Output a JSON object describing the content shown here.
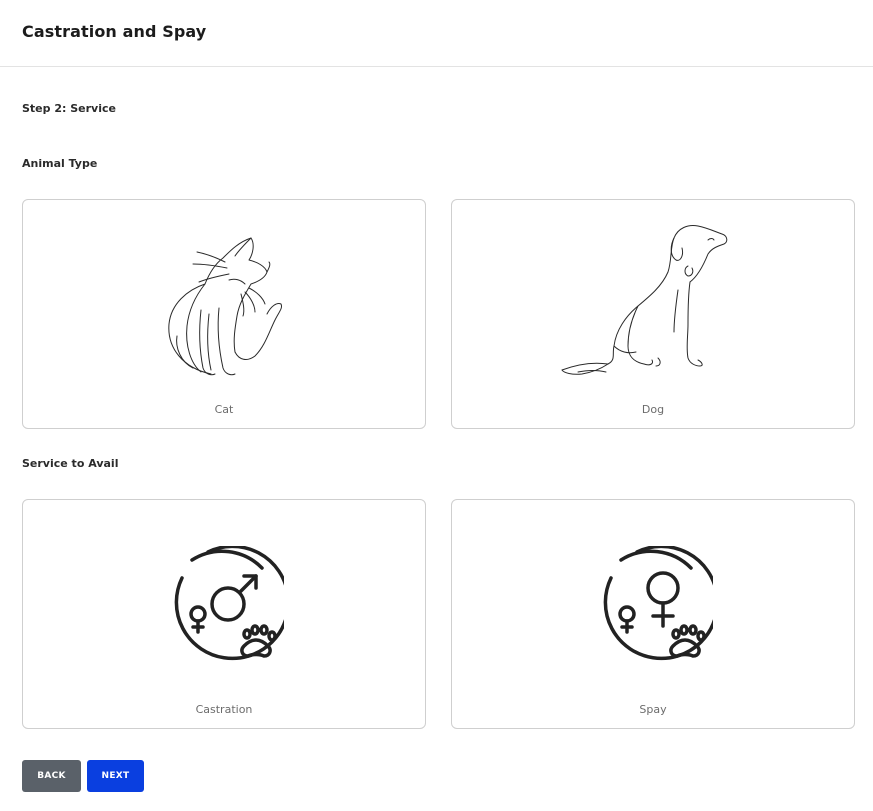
{
  "header": {
    "title": "Castration and Spay"
  },
  "step": {
    "label": "Step 2: Service"
  },
  "animal_type": {
    "heading": "Animal Type",
    "options": [
      {
        "label": "Cat",
        "icon": "cat-line-art-icon"
      },
      {
        "label": "Dog",
        "icon": "dog-line-art-icon"
      }
    ]
  },
  "service": {
    "heading": "Service to Avail",
    "options": [
      {
        "label": "Castration",
        "icon": "male-gender-paw-icon"
      },
      {
        "label": "Spay",
        "icon": "female-gender-paw-icon"
      }
    ]
  },
  "actions": {
    "back_label": "BACK",
    "next_label": "NEXT"
  },
  "colors": {
    "back_button": "#5a6169",
    "next_button": "#0a3fe0",
    "card_border": "#cfcfcf",
    "icon_stroke": "#222222"
  }
}
